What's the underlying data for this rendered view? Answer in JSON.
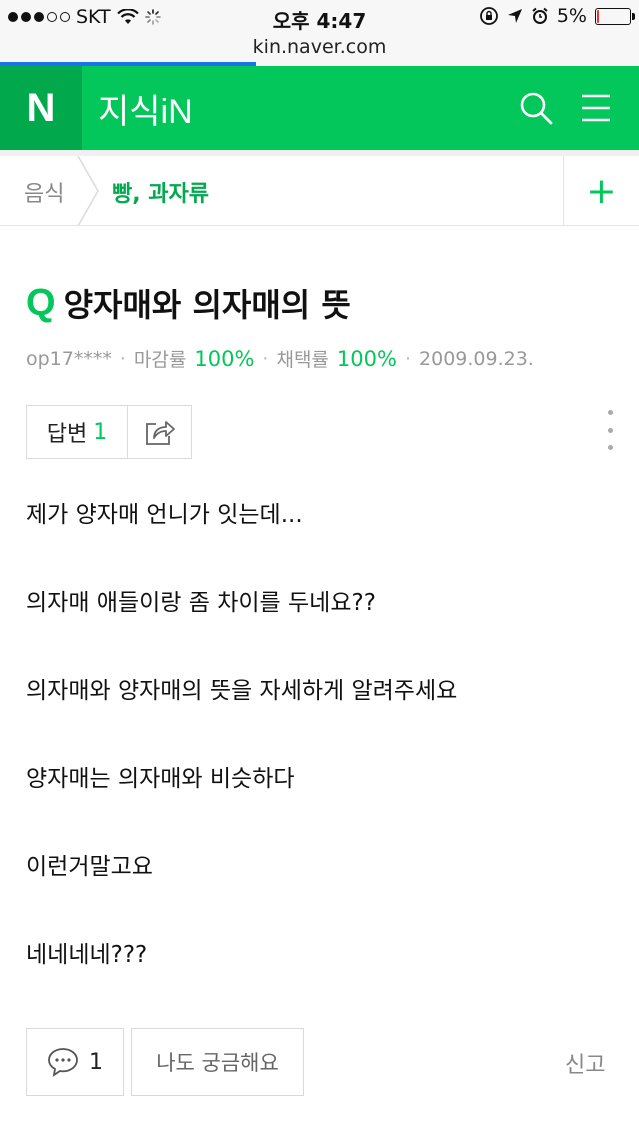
{
  "status_bar": {
    "carrier": "SKT",
    "time": "오후 4:47",
    "battery_percent": "5%",
    "battery_level": 0.05,
    "signal_bars_filled": 3,
    "signal_bars_total": 5
  },
  "browser": {
    "url": "kin.naver.com",
    "load_progress": 0.4
  },
  "header": {
    "logo": "N",
    "brand": "지식iN",
    "search_icon": "search-icon",
    "menu_icon": "hamburger-menu-icon",
    "brand_color": "#03c75a"
  },
  "breadcrumb": {
    "home": "음식",
    "current": "빵, 과자류",
    "add_label": "+"
  },
  "question": {
    "q_mark": "Q",
    "title": "양자매와 의자매의 뜻",
    "author": "op17****",
    "close_rate_label": "마감률",
    "close_rate_value": "100%",
    "adopt_rate_label": "채택률",
    "adopt_rate_value": "100%",
    "date": "2009.09.23.",
    "answer_label": "답변",
    "answer_count": "1",
    "body_lines": [
      "제가 양자매 언니가 잇는데...",
      "의자매 애들이랑 좀 차이를 두네요??",
      "의자매와 양자매의 뜻을 자세하게 알려주세요",
      "양자매는 의자매와 비슷하다",
      "이런거말고요",
      "네네네네???"
    ]
  },
  "actions": {
    "comment_count": "1",
    "curious_label": "나도 궁금해요",
    "report_label": "신고"
  }
}
